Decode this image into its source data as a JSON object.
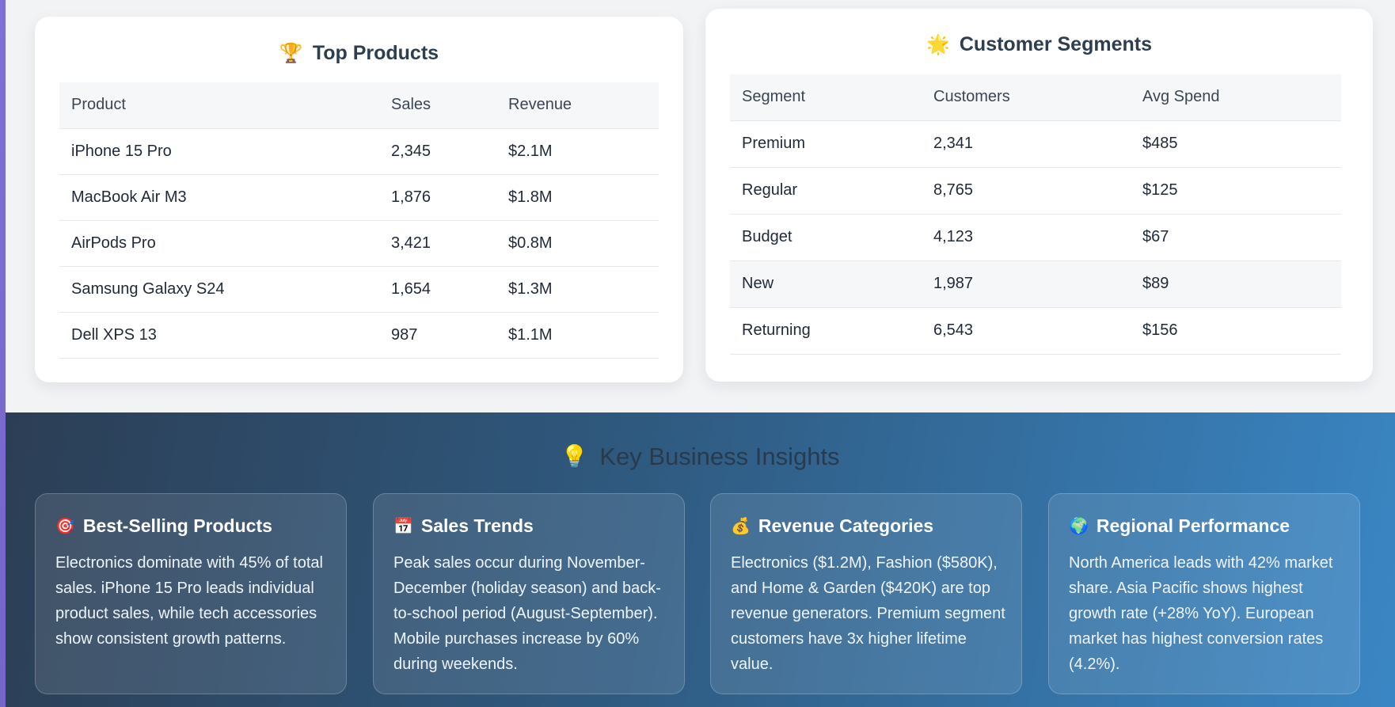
{
  "top_products": {
    "icon": "trophy-icon",
    "icon_glyph": "🏆",
    "title": "Top Products",
    "columns": [
      "Product",
      "Sales",
      "Revenue"
    ],
    "rows": [
      [
        "iPhone 15 Pro",
        "2,345",
        "$2.1M"
      ],
      [
        "MacBook Air M3",
        "1,876",
        "$1.8M"
      ],
      [
        "AirPods Pro",
        "3,421",
        "$0.8M"
      ],
      [
        "Samsung Galaxy S24",
        "1,654",
        "$1.3M"
      ],
      [
        "Dell XPS 13",
        "987",
        "$1.1M"
      ]
    ]
  },
  "customer_segments": {
    "icon": "sun-icon",
    "icon_glyph": "🌟",
    "title": "Customer Segments",
    "columns": [
      "Segment",
      "Customers",
      "Avg Spend"
    ],
    "rows": [
      [
        "Premium",
        "2,341",
        "$485"
      ],
      [
        "Regular",
        "8,765",
        "$125"
      ],
      [
        "Budget",
        "4,123",
        "$67"
      ],
      [
        "New",
        "1,987",
        "$89"
      ],
      [
        "Returning",
        "6,543",
        "$156"
      ]
    ],
    "highlighted_row": 3
  },
  "insights": {
    "icon": "lightbulb-icon",
    "icon_glyph": "💡",
    "title": "Key Business Insights",
    "cards": [
      {
        "icon": "target-icon",
        "icon_glyph": "🎯",
        "title": "Best-Selling Products",
        "text": "Electronics dominate with 45% of total sales. iPhone 15 Pro leads individual product sales, while tech accessories show consistent growth patterns."
      },
      {
        "icon": "calendar-icon",
        "icon_glyph": "📅",
        "title": "Sales Trends",
        "text": "Peak sales occur during November-December (holiday season) and back-to-school period (August-September). Mobile purchases increase by 60% during weekends."
      },
      {
        "icon": "money-bag-icon",
        "icon_glyph": "💰",
        "title": "Revenue Categories",
        "text": "Electronics ($1.2M), Fashion ($580K), and Home & Garden ($420K) are top revenue generators. Premium segment customers have 3x higher lifetime value."
      },
      {
        "icon": "globe-icon",
        "icon_glyph": "🌍",
        "title": "Regional Performance",
        "text": "North America leads with 42% market share. Asia Pacific shows highest growth rate (+28% YoY). European market has highest conversion rates (4.2%)."
      }
    ]
  }
}
